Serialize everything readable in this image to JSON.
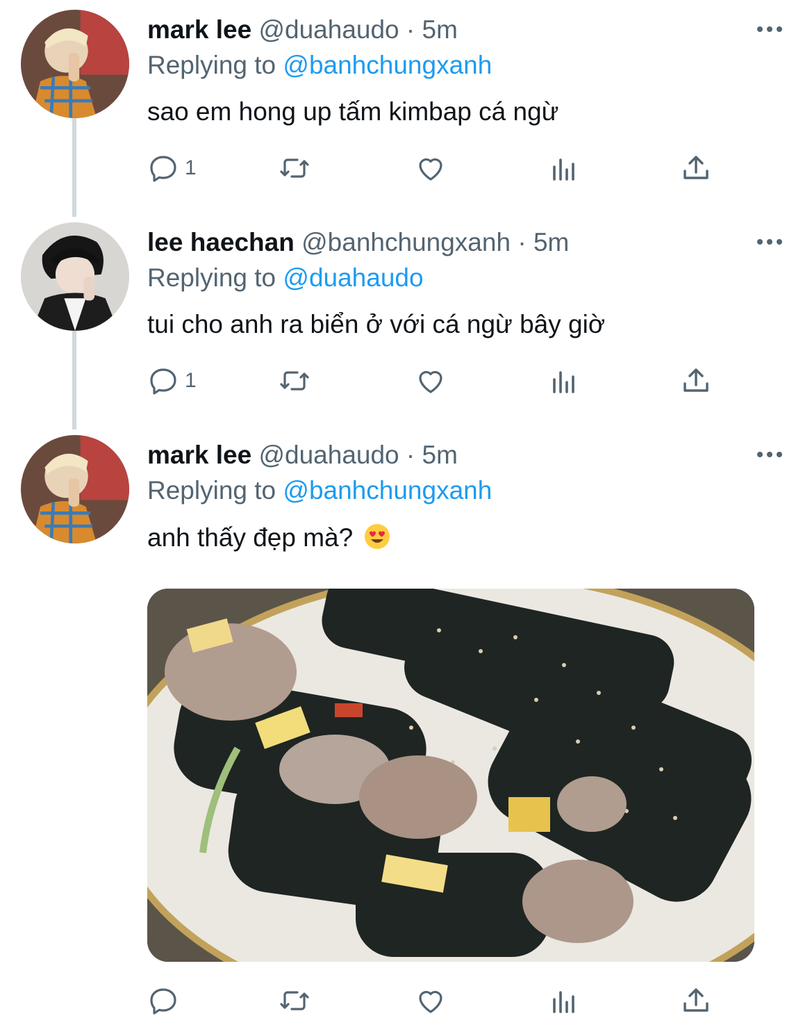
{
  "tweets": [
    {
      "name": "mark lee",
      "handle": "@duahaudo",
      "separator": "·",
      "time": "5m",
      "replying_prefix": "Replying to",
      "replying_to": "@banhchungxanh",
      "text": "sao em hong up tấm kimbap cá ngừ",
      "reply_count": "1"
    },
    {
      "name": "lee haechan",
      "handle": "@banhchungxanh",
      "separator": "·",
      "time": "5m",
      "replying_prefix": "Replying to",
      "replying_to": "@duahaudo",
      "text": "tui cho anh ra biển ở với cá ngừ bây giờ",
      "reply_count": "1"
    },
    {
      "name": "mark lee",
      "handle": "@duahaudo",
      "separator": "·",
      "time": "5m",
      "replying_prefix": "Replying to",
      "replying_to": "@banhchungxanh",
      "text": "anh thấy đẹp mà?",
      "emoji": "smiling-face-with-heart-eyes",
      "reply_count": ""
    }
  ],
  "colors": {
    "text_primary": "#0f1419",
    "text_secondary": "#536471",
    "link": "#1d9bf0",
    "thread_line": "#cfd9de"
  },
  "icons": [
    "reply-icon",
    "retweet-icon",
    "like-icon",
    "analytics-icon",
    "share-icon",
    "more-icon"
  ]
}
